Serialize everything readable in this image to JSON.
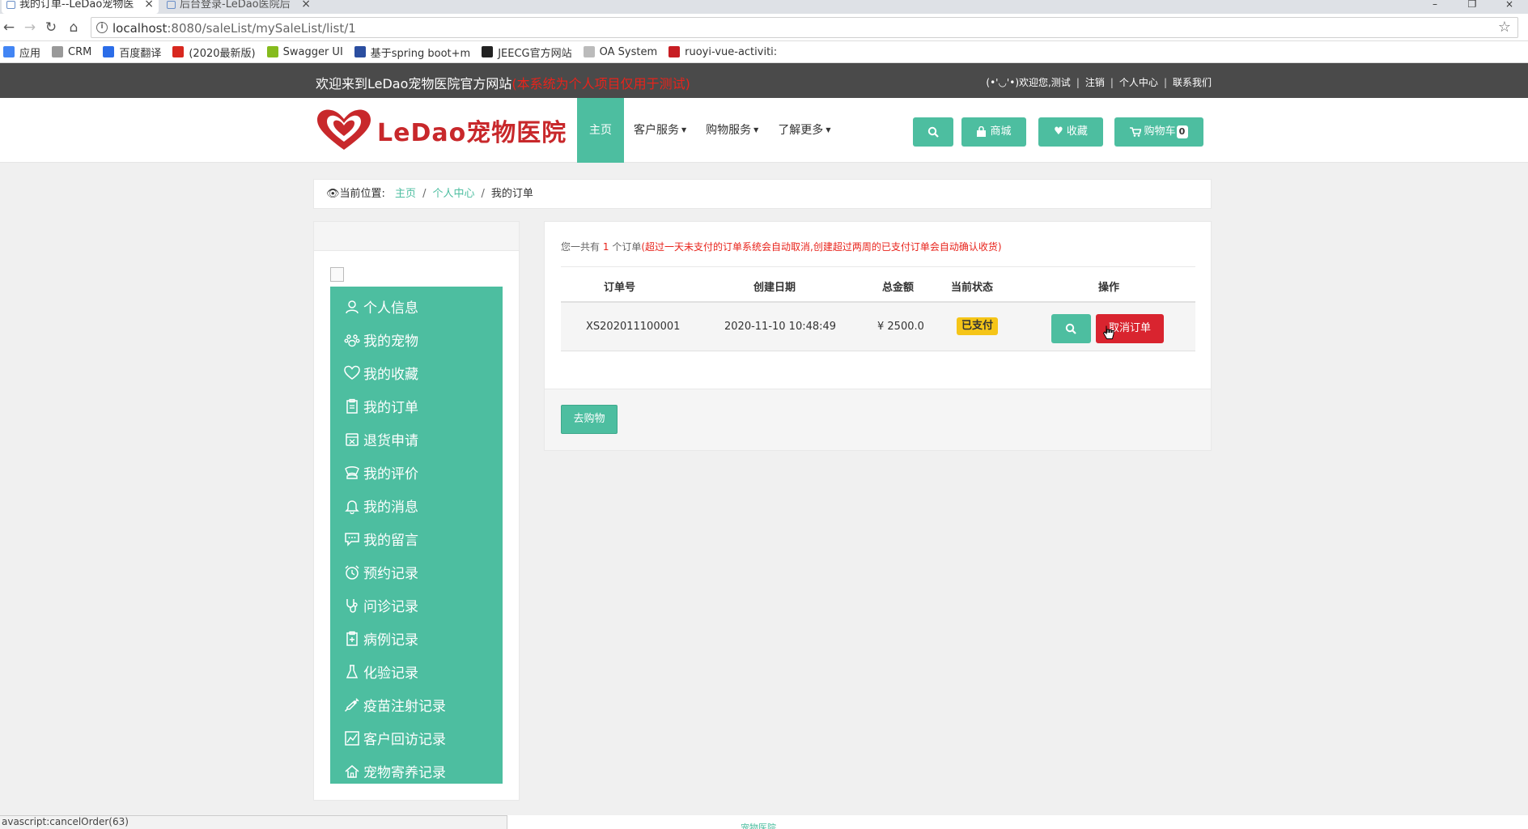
{
  "browser": {
    "tabs": [
      {
        "title": "我的订单--LeDao宠物医",
        "active": true
      },
      {
        "title": "后台登录-LeDao医院后",
        "active": false
      }
    ],
    "url_host": "localhost",
    "url_path": ":8080/saleList/mySaleList/list/1",
    "bookmarks": [
      {
        "label": "应用",
        "icon": "apps-grid-icon",
        "color": "#4285f4"
      },
      {
        "label": "CRM",
        "icon": "page-icon",
        "color": "#999999"
      },
      {
        "label": "百度翻译",
        "icon": "baidu-translate-icon",
        "color": "#2b6de8"
      },
      {
        "label": "(2020最新版)",
        "icon": "csdn-icon",
        "color": "#d8281f"
      },
      {
        "label": "Swagger UI",
        "icon": "swagger-icon",
        "color": "#85bb1d"
      },
      {
        "label": "基于spring boot+m",
        "icon": "bookmark-icon",
        "color": "#2b4ea0"
      },
      {
        "label": "JEECG官方网站",
        "icon": "jeecg-icon",
        "color": "#222222"
      },
      {
        "label": "OA System",
        "icon": "oa-icon",
        "color": "#bbbbbb"
      },
      {
        "label": "ruoyi-vue-activiti: ",
        "icon": "gitee-icon",
        "color": "#c71d23"
      }
    ],
    "status_text": "avascript:cancelOrder(63)"
  },
  "site": {
    "welcome": "欢迎来到LeDao宠物医院官方网站",
    "notice": "(本系统为个人项目仅用于测试)",
    "top_links": [
      "(•'◡'•)欢迎您,测试",
      "注销",
      "个人中心",
      "联系我们"
    ],
    "logo_text": "LeDao宠物医院",
    "nav": [
      {
        "label": "主页",
        "active": true,
        "dropdown": false
      },
      {
        "label": "客户服务",
        "active": false,
        "dropdown": true
      },
      {
        "label": "购物服务",
        "active": false,
        "dropdown": true
      },
      {
        "label": "了解更多",
        "active": false,
        "dropdown": true
      }
    ],
    "header_buttons": {
      "mall": "商城",
      "favorites": "收藏",
      "cart": "购物车",
      "cart_count": "0"
    },
    "accent_color": "#4dbea0",
    "danger_color": "#d9242f",
    "footer_link": "宠物医院"
  },
  "breadcrumb": {
    "prefix": "当前位置:",
    "items": [
      "主页",
      "个人中心",
      "我的订单"
    ]
  },
  "sidebar": {
    "items": [
      {
        "label": "个人信息",
        "icon": "user-icon"
      },
      {
        "label": "我的宠物",
        "icon": "paw-icon"
      },
      {
        "label": "我的收藏",
        "icon": "heart-icon"
      },
      {
        "label": "我的订单",
        "icon": "clipboard-icon"
      },
      {
        "label": "退货申请",
        "icon": "return-box-icon"
      },
      {
        "label": "我的评价",
        "icon": "review-icon"
      },
      {
        "label": "我的消息",
        "icon": "bell-icon"
      },
      {
        "label": "我的留言",
        "icon": "chat-icon"
      },
      {
        "label": "预约记录",
        "icon": "alarm-clock-icon"
      },
      {
        "label": "问诊记录",
        "icon": "stethoscope-icon"
      },
      {
        "label": "病例记录",
        "icon": "medical-record-icon"
      },
      {
        "label": "化验记录",
        "icon": "flask-icon"
      },
      {
        "label": "疫苗注射记录",
        "icon": "syringe-icon"
      },
      {
        "label": "客户回访记录",
        "icon": "chart-icon"
      },
      {
        "label": "宠物寄养记录",
        "icon": "house-icon"
      }
    ]
  },
  "orders": {
    "summary_prefix": "您一共有",
    "count": "1",
    "summary_suffix": "个订单",
    "warning": "(超过一天未支付的订单系统会自动取消,创建超过两周的已支付订单会自动确认收货)",
    "columns": [
      "订单号",
      "创建日期",
      "总金额",
      "当前状态",
      "操作"
    ],
    "rows": [
      {
        "order_no": "XS202011100001",
        "created": "2020-11-10 10:48:49",
        "amount": "¥ 2500.0",
        "status": "已支付",
        "cancel_label": "取消订单"
      }
    ],
    "shop_button": "去购物"
  }
}
